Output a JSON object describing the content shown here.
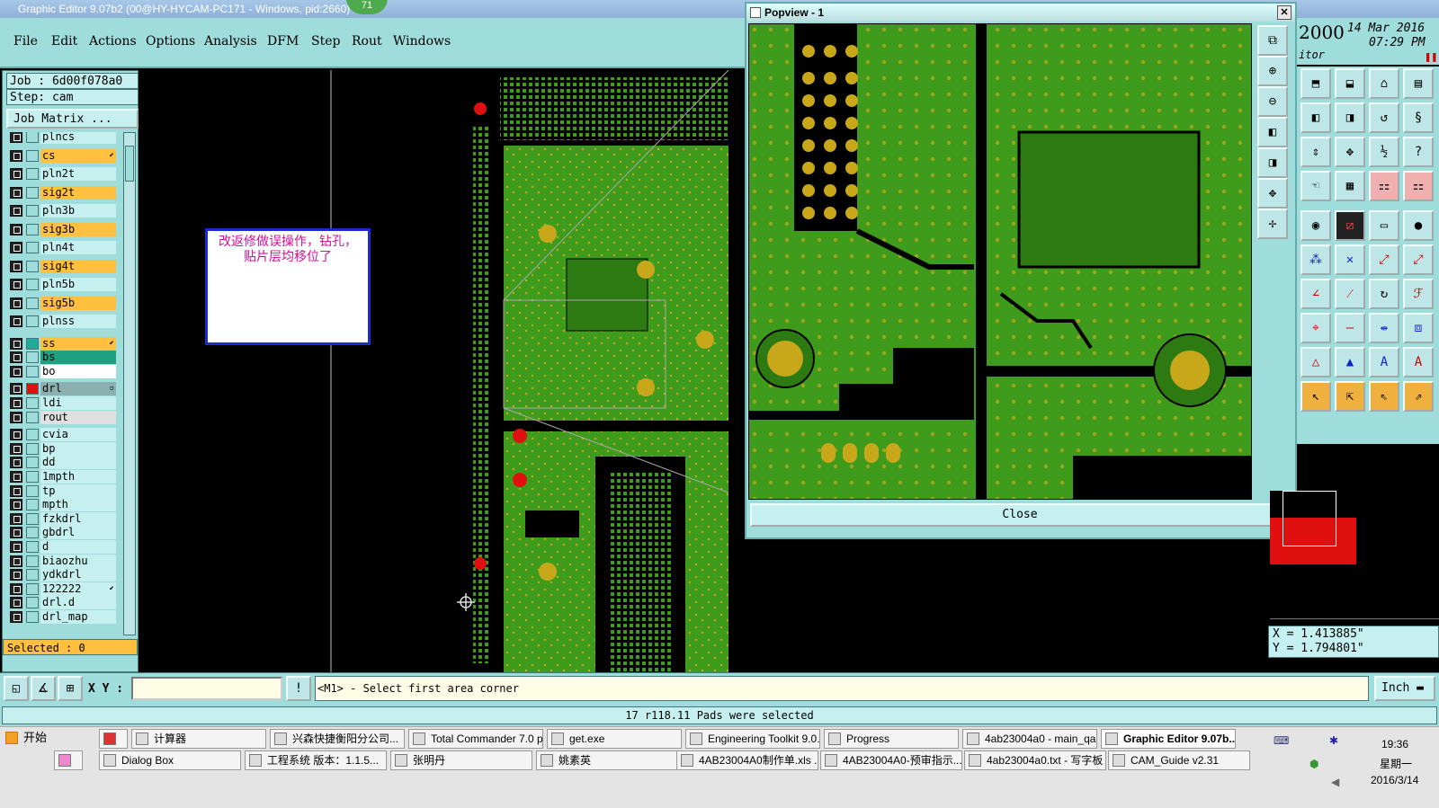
{
  "window": {
    "title": "Graphic Editor 9.07b2 (00@HY-HYCAM-PC171 - Windows, pid:2660)",
    "badge": "71"
  },
  "menu": [
    "File",
    "Edit",
    "Actions",
    "Options",
    "Analysis",
    "DFM",
    "Step",
    "Rout",
    "Windows"
  ],
  "job": {
    "job_line": "Job : 6d00f078a0",
    "step_line": "Step: cam",
    "matrix_button": "Job Matrix ..."
  },
  "layers": [
    {
      "name": "plncs",
      "color": "#c6f0f0"
    },
    {
      "name": "cs",
      "color": "#ffc040",
      "mark": "⬋"
    },
    {
      "name": "pln2t",
      "color": "#c6f0f0"
    },
    {
      "name": "sig2t",
      "color": "#ffc040"
    },
    {
      "name": "pln3b",
      "color": "#c6f0f0"
    },
    {
      "name": "sig3b",
      "color": "#ffc040"
    },
    {
      "name": "pln4t",
      "color": "#c6f0f0"
    },
    {
      "name": "sig4t",
      "color": "#ffc040"
    },
    {
      "name": "pln5b",
      "color": "#c6f0f0"
    },
    {
      "name": "sig5b",
      "color": "#ffc040"
    },
    {
      "name": "plnss",
      "color": "#c6f0f0"
    },
    {
      "name": "ss",
      "color": "#ffc040",
      "mark": "⬋"
    },
    {
      "name": "bs",
      "color": "#20a080"
    },
    {
      "name": "bo",
      "color": "#ffffff"
    },
    {
      "name": "drl",
      "color": "#8cb0b0",
      "mark": "▫"
    },
    {
      "name": "ldi",
      "color": "#c6f0f0"
    },
    {
      "name": "rout",
      "color": "#e0e0e0"
    },
    {
      "name": "cvia",
      "color": "#c6f0f0"
    },
    {
      "name": "bp",
      "color": "#c6f0f0"
    },
    {
      "name": "dd",
      "color": "#c6f0f0"
    },
    {
      "name": "1mpth",
      "color": "#c6f0f0"
    },
    {
      "name": "tp",
      "color": "#c6f0f0"
    },
    {
      "name": "mpth",
      "color": "#c6f0f0"
    },
    {
      "name": "fzkdrl",
      "color": "#c6f0f0"
    },
    {
      "name": "gbdrl",
      "color": "#c6f0f0"
    },
    {
      "name": "d",
      "color": "#c6f0f0"
    },
    {
      "name": "biaozhu",
      "color": "#c6f0f0"
    },
    {
      "name": "ydkdrl",
      "color": "#c6f0f0"
    },
    {
      "name": "122222",
      "color": "#c6f0f0",
      "mark": "⬋"
    },
    {
      "name": "drl.d",
      "color": "#c6f0f0"
    },
    {
      "name": "drl_map",
      "color": "#c6f0f0"
    }
  ],
  "selected_label": "Selected : 0",
  "note_text": "改返修做误操作，钻孔，贴片层均移位了",
  "popview": {
    "title": "Popview - 1",
    "close_label": "Close",
    "close_x": "✕"
  },
  "clock": {
    "year": "2000",
    "date": "14 Mar 2016",
    "time": "07:29 PM",
    "subtitle": "itor"
  },
  "coords": {
    "x": "X = 1.413885\"",
    "y": "Y = 1.794801\""
  },
  "command": {
    "xy_label": "X Y :",
    "prompt": "<M1> - Select first area corner",
    "unit": "Inch"
  },
  "status_text": "17 r118.11 Pads were selected",
  "taskbar": {
    "start": "开始",
    "row1": [
      "计算器",
      "兴森快捷衡阳分公司...",
      "Total Commander 7.0 p...",
      "get.exe",
      "Engineering Toolkit 9.0...",
      "Progress",
      "4ab23004a0 - main_qa",
      "Graphic Editor 9.07b..."
    ],
    "row2": [
      "Dialog Box",
      "工程系统  版本：1.1.5...",
      "张明丹",
      "姚素英",
      "4AB23004A0制作单.xls ...",
      "4AB23004A0-预审指示...",
      "4ab23004a0.txt - 写字板",
      "CAM_Guide v2.31"
    ],
    "time": "19:36",
    "weekday": "星期一",
    "date": "2016/3/14"
  },
  "colors": {
    "board": "#3e9b1c",
    "pad": "#c8a81a",
    "drill": "#e01010",
    "panel": "#9fdcdc"
  }
}
